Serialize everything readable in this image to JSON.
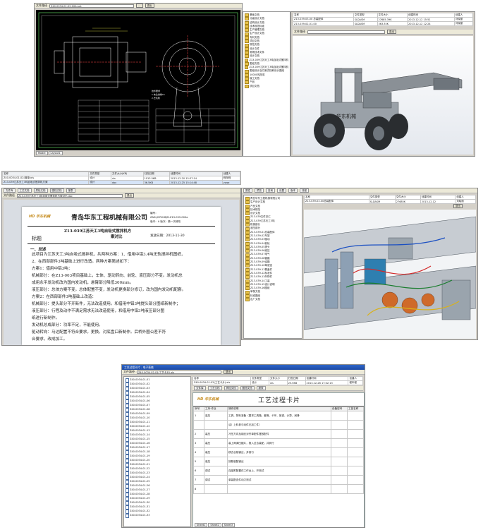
{
  "topLeft": {
    "file_label": "文件路径",
    "file_path": "Z40-0034-01-02-00A.ack",
    "exit": "退出",
    "cad_tabs": [
      "Model",
      "Layout1"
    ]
  },
  "topMiddle": {
    "tree_items": [
      "基础文档",
      "分级设计文档",
      "结构设计文档",
      "技术规范标准",
      "生产管理文档",
      "生产设计文档",
      "专利文档",
      "项目文档",
      "规范文档",
      "设计文件",
      "常规技术文件",
      "设计文档",
      "Z13-039江苏天工3吨自吸式搅拌机",
      "图纸文档",
      "Z13-039江苏天工3吨自吸式搅拌机",
      "图纸设计及方案文档和设计图纸",
      "10000吨压机",
      "竣工文档",
      "产品",
      "项目文档"
    ]
  },
  "topRight": {
    "headers": [
      "名称",
      "文件类型",
      "文件大小",
      "创建时间",
      "创建人"
    ],
    "rows": [
      [
        "Z13-039-03-00 总装配体",
        "SLDASM",
        "27685.39K",
        "2013-12-12 15:51",
        "刘晓丽"
      ],
      [
        "Z13-039-02-01-00",
        "SLDASM",
        "363.35K",
        "2013-12-12 12:24",
        "刘晓丽"
      ]
    ],
    "file_label": "文件路径",
    "exit": "退出",
    "status": "华东机械"
  },
  "middleStrip": {
    "headers": [
      "名称",
      "文件类型",
      "文件大小(KB)",
      "归档日期",
      "创建时间",
      "创建人"
    ],
    "rows": [
      [
        "Z40-0034-01-02(清单)xls",
        "设计",
        "xls",
        "1013.5KB",
        "2013-12-20 15:37:14",
        "程年程"
      ],
      [
        "Z13-039江苏天工3吨自吸式搅拌机方案",
        "设计",
        "doc",
        "36.5KB",
        "2013-12-25 15:14:48",
        "ywzz"
      ]
    ]
  },
  "docWin": {
    "tabs": [
      "文件库",
      "工艺文档",
      "质检文档",
      "图档文档",
      "报表"
    ],
    "file_label": "文件路径",
    "file_path": "Z13-039江苏天工3吨自吸式搅拌机方案对比.doc",
    "exit": "退出",
    "logo": "HD 华东机械",
    "company": "青岛华东工程机械有限公司",
    "meta1": "编号：",
    "meta2": "ZAD-JMFW-BJM-Z13-039-000a",
    "meta3": "版本：A  版次：第一次修改",
    "mark": "标题",
    "title1": "Z13-039江苏天工3吨自吸式搅拌机方",
    "title2": "案对比",
    "date": "发放日期：2013-11-30",
    "sec": "一、总述",
    "lines": [
      "此项目为江苏天工3吨自吸式搅拌机，共两种方案：1、借用中铝3.4吨无轨搅拌机图纸，",
      "2、在西部部件3吨基础上进行改造。两种方案简述如下：",
      "方案1：借用中铝3吨：",
      "机械部分：在Z13-003项目基础上，车体、驱动转向、前轮、液压部分不变。发动机总",
      "成用永平发动机改为国内发动机，悬臂部分降低300mm。",
      "液压部分：总体方案不变。总体配置不变，发动机更换部分修订，改为国内发动机配套。",
      "方案2：在西部部件3吨基础上改造：",
      "机械部分：提头部分不开新件，无法改造使用。和借用中铝3吨提头部分图纸新制作；",
      "液压部分：行程及动作不满足需求无法改造使用，和借用中铝3吨液压部分图",
      "纸进行新制作。",
      "发动机总成部分：功率不足，不能使用。",
      "驱动转向：马达配置不符合要求，更换。对底盘口新制作。后桥外圈公差不符",
      "合要求，改成加工。"
    ]
  },
  "cadWin2": {
    "tabs": [
      "属性",
      "预览",
      "查询",
      "设置",
      "版本",
      "流程"
    ],
    "tree_items": [
      "青岛华东工程机械有限公司",
      "生产设计文档",
      "产品文档",
      "技术规范",
      "设计文档",
      "Z13-039文件总汇",
      "Z13-039江苏天工3吨",
      "机械部分",
      "液压部分",
      "Z13-039-01总装配体",
      "Z13-039-02车架",
      "Z13-039-03驱动",
      "Z13-039-04前轮",
      "Z13-039-05提头",
      "Z13-039-06液压",
      "Z13-039-07电气",
      "Z13-039-08管路",
      "Z13-039-09油箱",
      "Z13-039-10驾驶室",
      "Z13-039-11覆盖件",
      "Z13-039-12标准件",
      "Z13-039-13外购件",
      "Z13-039-14工装",
      "Z13-039-15设计说明",
      "Z13-039-16图纸",
      "审核文档",
      "标准图纸",
      "出厂文档"
    ],
    "table_headers": [
      "名称",
      "文件类型",
      "文件大小",
      "创建时间",
      "创建人"
    ],
    "table_rows": [
      [
        "Z13-039-03-00总装配体",
        "SLDASM",
        "27685K",
        "2013-12-12",
        "刘晓丽"
      ]
    ],
    "exit": "退出"
  },
  "excelWin": {
    "title": "工艺过程卡片 - 电子表格",
    "file_label": "文件路径",
    "file_path": "Z40-0034-02-01(工艺卡片).xls",
    "exit": "退出",
    "table_headers": [
      "名称",
      "文件类型",
      "文件大小",
      "归档日期",
      "创建时间",
      "创建人"
    ],
    "table_row": [
      "Z40-0034-01-02(工艺卡片).xls",
      "设计",
      "xls",
      "25.5KB",
      "2013-12-26 17:02:13",
      "程年程"
    ],
    "tabs": [
      "文件库",
      "工艺文档",
      "质检文档",
      "图档文档",
      "报表"
    ],
    "tree_items": [
      "Z40-0034-01-01",
      "Z40-0034-01-02",
      "Z40-0034-01-03",
      "Z40-0034-01-04",
      "Z40-0034-01-05",
      "Z40-0034-01-06",
      "Z40-0034-01-07",
      "Z40-0034-01-08",
      "Z40-0034-01-09",
      "Z40-0034-01-10",
      "Z40-0034-01-11",
      "Z40-0034-01-12",
      "Z40-0034-01-13",
      "Z40-0034-01-14",
      "Z40-0034-01-15",
      "Z40-0034-01-16",
      "Z40-0034-01-17",
      "Z40-0034-01-18",
      "Z40-0034-01-19",
      "Z40-0034-01-20",
      "Z40-0034-01-21",
      "Z40-0034-01-22",
      "Z40-0034-01-23",
      "Z40-0034-01-24",
      "Z40-0034-01-25",
      "Z40-0034-01-26",
      "Z40-0034-01-27",
      "Z40-0034-01-28",
      "Z40-0034-01-29",
      "Z40-0034-01-30",
      "Z40-0034-01-31",
      "Z40-0034-01-32",
      "Z40-0034-01-33"
    ],
    "logo": "HD 华东机械",
    "card_title": "工艺过程卡片",
    "col_headers": [
      "序号",
      "工序·作业",
      "操作说明",
      "设备型号",
      "工装名称"
    ],
    "rows": [
      [
        "1",
        "装压",
        "工具、物料准备（要求工具箱、套筒、卡环、扳钳、计算、润滑",
        "",
        ""
      ],
      [
        "",
        "",
        "油）上料参与动件无加工件）",
        "",
        ""
      ],
      [
        "2",
        "装压",
        "冷压方向及钢丝对齐单配件摆放配件",
        "",
        ""
      ],
      [
        "3",
        "装压",
        "装上两调压腿片，推入过合装配，并到行",
        "",
        ""
      ],
      [
        "4",
        "装压",
        "移去合相钢丝，并到行",
        "",
        ""
      ],
      [
        "5",
        "装压",
        "按照装配钢丝",
        "",
        ""
      ],
      [
        "6",
        "调试",
        "连接附配置在工作台上，开测试",
        "",
        ""
      ],
      [
        "7",
        "调试",
        "单装配连件动力测试",
        "",
        ""
      ],
      [
        "8",
        "",
        "",
        "",
        ""
      ]
    ],
    "sheet_tabs": [
      "Sheet1",
      "Sheet2",
      "Sheet3"
    ]
  }
}
